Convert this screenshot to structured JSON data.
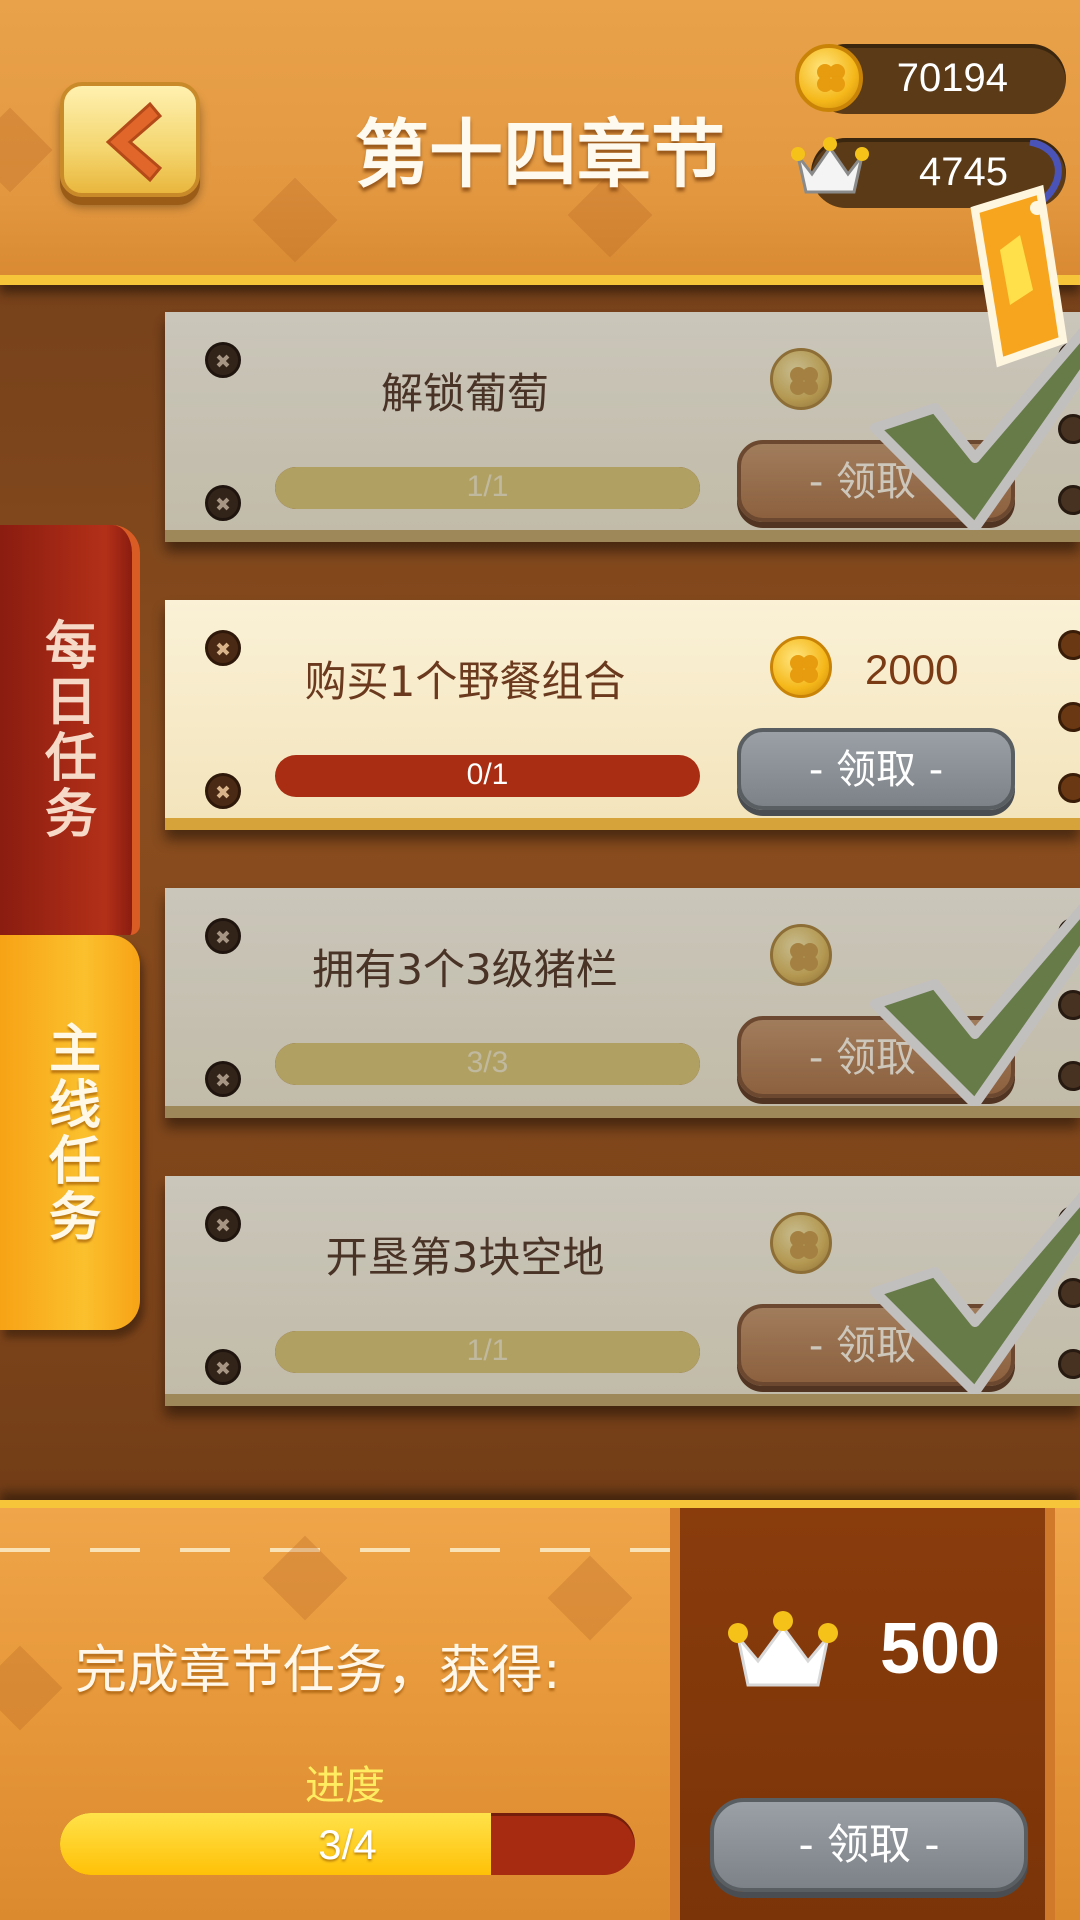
{
  "header": {
    "title": "第十四章节",
    "coins": "70194",
    "crowns": "4745"
  },
  "tabs": {
    "daily": "每日任务",
    "main": "主线任务",
    "active": "main"
  },
  "tasks": [
    {
      "title": "解锁葡萄",
      "progress_text": "1/1",
      "progress": 1.0,
      "reward_amount": "",
      "claim_label": "- 领取 -",
      "completed": true
    },
    {
      "title": "购买1个野餐组合",
      "progress_text": "0/1",
      "progress": 0.0,
      "reward_amount": "2000",
      "claim_label": "- 领取 -",
      "completed": false
    },
    {
      "title": "拥有3个3级猪栏",
      "progress_text": "3/3",
      "progress": 1.0,
      "reward_amount": "",
      "claim_label": "- 领取 -",
      "completed": true
    },
    {
      "title": "开垦第3块空地",
      "progress_text": "1/1",
      "progress": 1.0,
      "reward_amount": "",
      "claim_label": "- 领取 -",
      "completed": true
    }
  ],
  "chapter_reward": {
    "label": "完成章节任务，获得:",
    "progress_label": "进度",
    "progress_text": "3/4",
    "progress": 0.75,
    "amount": "500",
    "claim_label": "- 领取 -"
  },
  "colors": {
    "header_bg": "#e39840",
    "accent_yellow": "#f6c53a",
    "progress_red": "#a82d12",
    "check_green": "#6f9e2e"
  },
  "icons": [
    "back-arrow-icon",
    "coin-icon",
    "crown-icon",
    "price-tag-icon",
    "checkmark-icon",
    "clover-icon"
  ]
}
